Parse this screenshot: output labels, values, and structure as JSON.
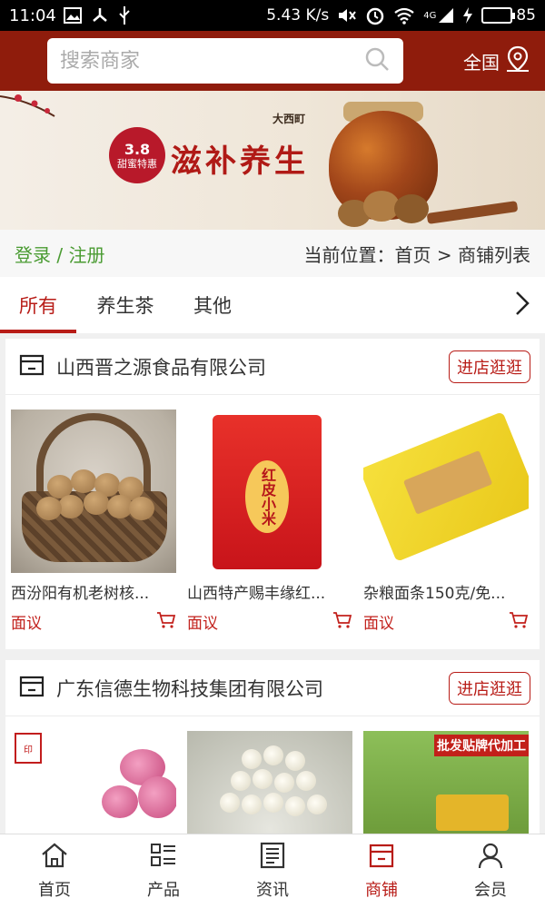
{
  "status_bar": {
    "time": "11:04",
    "speed": "5.43 K/s",
    "network": "4G",
    "battery": "85",
    "battery_level_percent": 85
  },
  "header": {
    "search_placeholder": "搜索商家",
    "region_label": "全国"
  },
  "banner": {
    "badge_line1": "3.8",
    "badge_line2": "甜蜜特惠",
    "title": "滋补养生",
    "brand": "大西町"
  },
  "breadcrumb": {
    "login": "登录 / 注册",
    "location": "当前位置：首页 > 商铺列表"
  },
  "tabs": [
    {
      "label": "所有",
      "active": true
    },
    {
      "label": "养生茶",
      "active": false
    },
    {
      "label": "其他",
      "active": false
    }
  ],
  "shops": [
    {
      "name": "山西晋之源食品有限公司",
      "enter_label": "进店逛逛",
      "products": [
        {
          "name": "西汾阳有机老树核...",
          "price": "面议"
        },
        {
          "name": "山西特产赐丰缘红...",
          "price": "面议"
        },
        {
          "name": "杂粮面条150克/免...",
          "price": "面议"
        }
      ]
    },
    {
      "name": "广东信德生物科技集团有限公司",
      "enter_label": "进店逛逛",
      "products": [
        {
          "name": "",
          "price": ""
        },
        {
          "name": "",
          "price": ""
        },
        {
          "name": "",
          "price": "",
          "image_text": "批发贴牌代加工"
        }
      ]
    }
  ],
  "product_image_text": {
    "bag_label": "红皮小米"
  },
  "bottom_nav": [
    {
      "label": "首页",
      "icon": "home-icon",
      "active": false
    },
    {
      "label": "产品",
      "icon": "grid-list-icon",
      "active": false
    },
    {
      "label": "资讯",
      "icon": "news-icon",
      "active": false
    },
    {
      "label": "商铺",
      "icon": "store-icon",
      "active": true
    },
    {
      "label": "会员",
      "icon": "user-icon",
      "active": false
    }
  ],
  "colors": {
    "header_bg": "#8f1c0c",
    "accent_red": "#b81c17",
    "login_green": "#4a9b32"
  }
}
